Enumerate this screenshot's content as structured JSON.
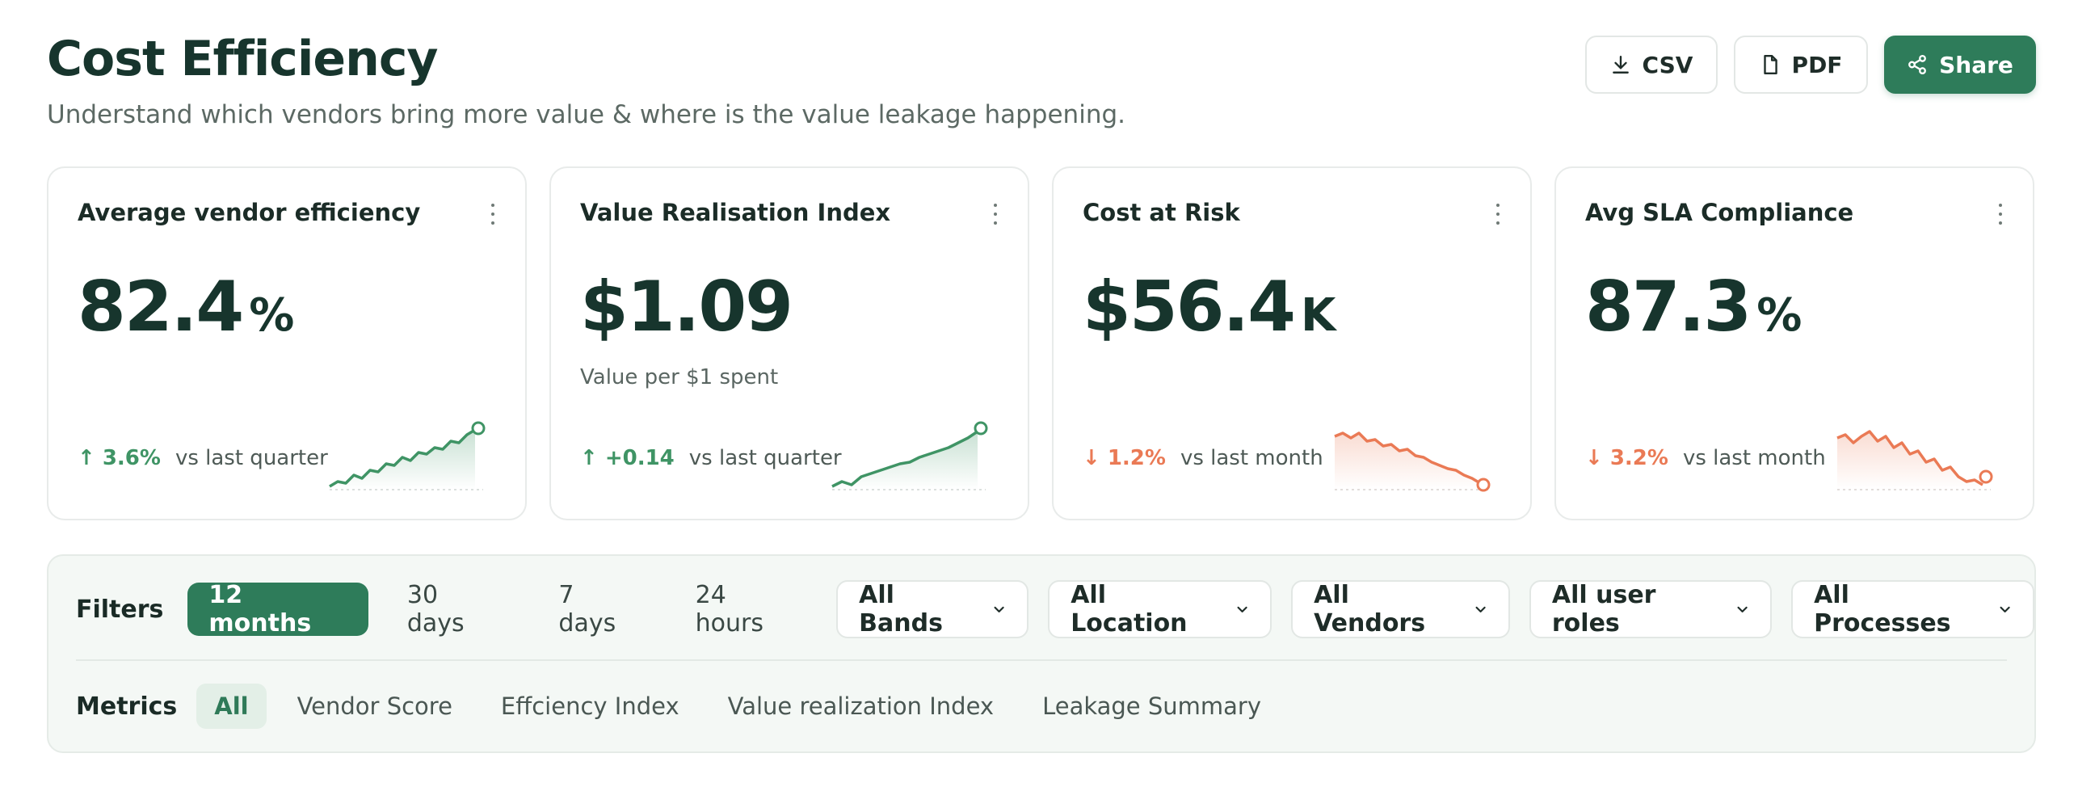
{
  "header": {
    "title": "Cost Efficiency",
    "subtitle": "Understand which vendors bring more value & where is the value leakage happening."
  },
  "actions": {
    "csv_label": "CSV",
    "pdf_label": "PDF",
    "share_label": "Share"
  },
  "cards": [
    {
      "title": "Average vendor efficiency",
      "value": "82.4",
      "unit": "%",
      "note": "",
      "delta": "↑ 3.6%",
      "direction": "up",
      "context": "vs last quarter"
    },
    {
      "title": "Value Realisation Index",
      "value": "$1.09",
      "unit": "",
      "note": "Value per $1 spent",
      "delta": "↑ +0.14",
      "direction": "up",
      "context": "vs last quarter"
    },
    {
      "title": "Cost at Risk",
      "value": "$56.4",
      "unit": "K",
      "note": "",
      "delta": "↓ 1.2%",
      "direction": "down",
      "context": "vs last month"
    },
    {
      "title": "Avg SLA Compliance",
      "value": "87.3",
      "unit": "%",
      "note": "",
      "delta": "↓ 3.2%",
      "direction": "down",
      "context": "vs last month"
    }
  ],
  "filters": {
    "label": "Filters",
    "ranges": [
      "12 months",
      "30 days",
      "7 days",
      "24 hours"
    ],
    "active_range": "12 months",
    "dropdowns": [
      "All Bands",
      "All Location",
      "All Vendors",
      "All user roles",
      "All Processes"
    ]
  },
  "metrics": {
    "label": "Metrics",
    "tabs": [
      "All",
      "Vendor Score",
      "Effciency Index",
      "Value realization Index",
      "Leakage Summary"
    ],
    "active_tab": "All"
  },
  "colors": {
    "primary": "#2e7c5a",
    "up": "#3f9465",
    "down": "#ea7a55",
    "title": "#17352d"
  }
}
